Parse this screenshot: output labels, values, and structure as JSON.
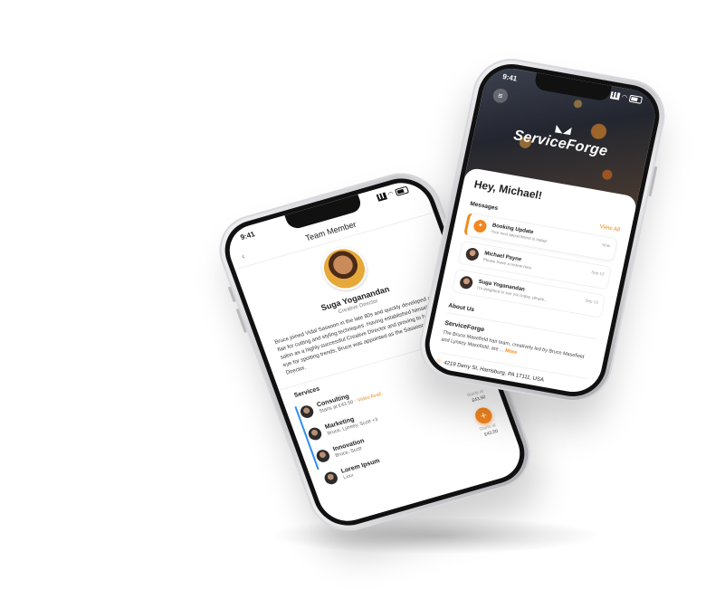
{
  "left_phone": {
    "status_time": "9:41",
    "header_title": "Team Member",
    "back_icon": "chevron-left-icon",
    "profile": {
      "name": "Suga Yoganandan",
      "role": "Creative Director",
      "bio": "Bruce joined Vidal Sassoon in the late 80s and quickly developed a natural flair for cutting and styling techniques. Having established himself in the salon as a highly successful Creative Director and proving to have a keen eye for spotting trends, Bruce was appointed as the Sassoon UK Creative Director."
    },
    "services_label": "Services",
    "services": [
      {
        "title": "Consulting",
        "sub": "Starts at £43.50 ·",
        "sub_highlight": "Video Avail."
      },
      {
        "title": "Marketing",
        "sub": "Bruce, Lynsey, Scott +3",
        "sub_highlight": ""
      },
      {
        "title": "Innovation",
        "sub": "Bruce, Scott",
        "sub_highlight": ""
      },
      {
        "title": "Lorem Ipsum",
        "sub": "Lxxx",
        "sub_highlight": ""
      }
    ],
    "price_panel": {
      "label_top": "Starts at",
      "price_top": "£43.50",
      "label_bottom": "Starts at",
      "price_bottom": "£43.50"
    },
    "fab_label": "+",
    "accent_color": "#f3861f",
    "rail_color": "#2e8ff0"
  },
  "right_phone": {
    "status_time": "9:41",
    "menu_icon": "hamburger-menu-icon",
    "brand_name": "ServiceForge",
    "greeting": "Hey, Michael!",
    "messages_label": "Messages",
    "view_all_label": "View All",
    "messages": [
      {
        "title": "Booking Update",
        "preview": "Your next appointment is today!",
        "time": "Now"
      },
      {
        "title": "Michael Payne",
        "preview": "Please leave a review here",
        "time": "Sep 13"
      },
      {
        "title": "Suga Yoganandan",
        "preview": "I'm delighted to see you today, please...",
        "time": "Sep 13"
      }
    ],
    "about_label": "About Us",
    "about_title": "ServiceForge",
    "about_text": "The Bruce Masefield hair team, creatively led by Bruce Masefield and Lynsey Masefield, are ...",
    "more_label": "More",
    "address": "4219 Derry St, Harrisburg, PA 17111, USA",
    "accent_color": "#f08a1c"
  }
}
